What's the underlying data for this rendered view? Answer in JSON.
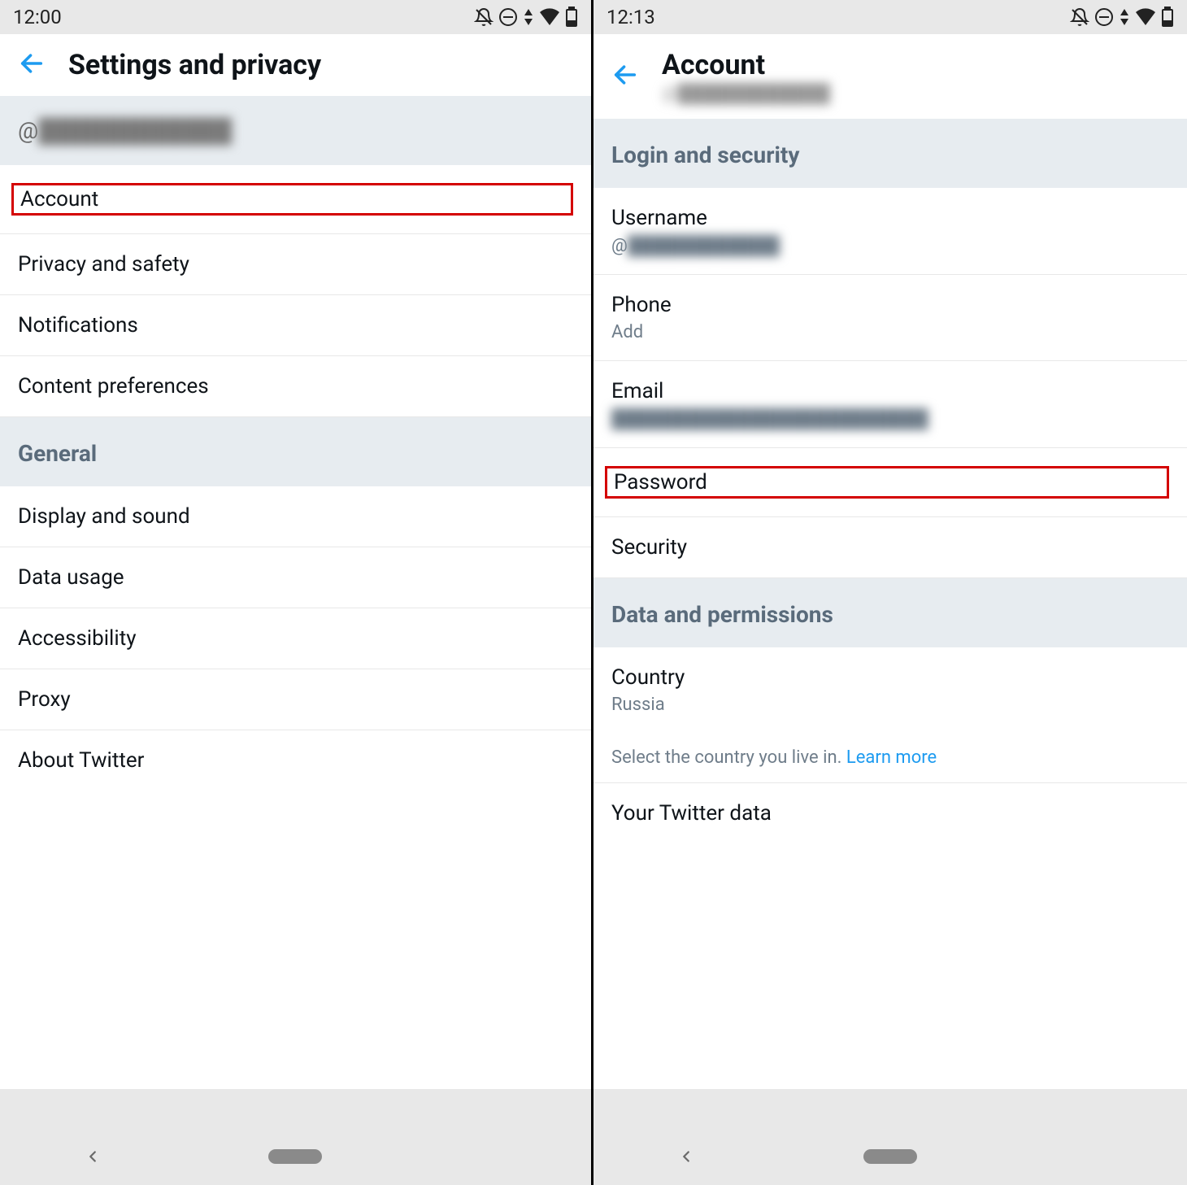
{
  "left": {
    "statusbar": {
      "time": "12:00"
    },
    "appbar": {
      "title": "Settings and privacy"
    },
    "handle_prefix": "@",
    "handle_blurred": "████████████",
    "items_top": [
      {
        "label": "Account",
        "highlight": true
      },
      {
        "label": "Privacy and safety"
      },
      {
        "label": "Notifications"
      },
      {
        "label": "Content preferences"
      }
    ],
    "general_header": "General",
    "items_general": [
      {
        "label": "Display and sound"
      },
      {
        "label": "Data usage"
      },
      {
        "label": "Accessibility"
      },
      {
        "label": "Proxy"
      },
      {
        "label": "About Twitter"
      }
    ]
  },
  "right": {
    "statusbar": {
      "time": "12:13"
    },
    "appbar": {
      "title": "Account",
      "sub_prefix": "@",
      "sub_blurred": "████████████"
    },
    "section1": "Login and security",
    "username": {
      "label": "Username",
      "value_prefix": "@",
      "value_blurred": "████████████"
    },
    "phone": {
      "label": "Phone",
      "value": "Add"
    },
    "email": {
      "label": "Email",
      "value_blurred": "█████████████████████████"
    },
    "password": {
      "label": "Password",
      "highlight": true
    },
    "security": {
      "label": "Security"
    },
    "section2": "Data and permissions",
    "country": {
      "label": "Country",
      "value": "Russia"
    },
    "country_help": "Select the country you live in. ",
    "country_help_link": "Learn more",
    "twitter_data": {
      "label": "Your Twitter data"
    }
  }
}
